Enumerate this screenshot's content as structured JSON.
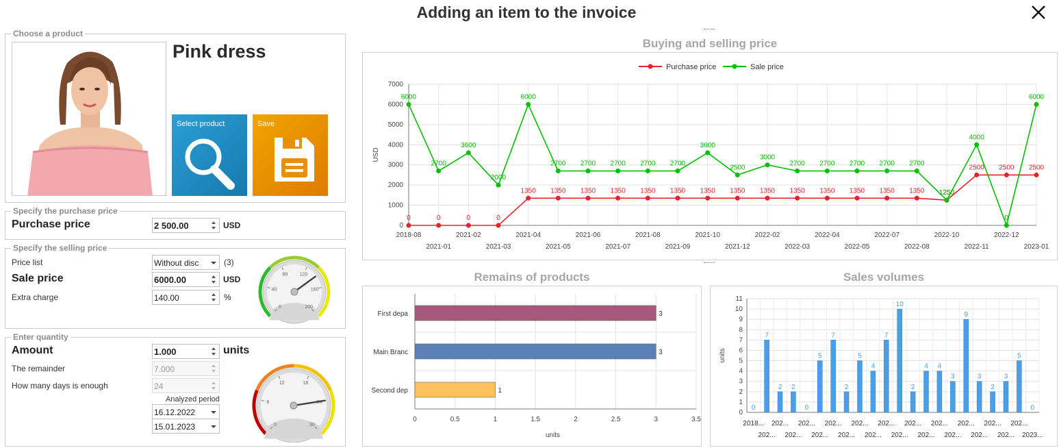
{
  "window": {
    "title": "Adding an item to the invoice"
  },
  "product_group": {
    "legend": "Choose a product",
    "name": "Pink dress",
    "select_label": "Select product",
    "save_label": "Save"
  },
  "purchase_group": {
    "legend": "Specify the purchase price",
    "label": "Purchase price",
    "value": "2 500.00",
    "unit": "USD"
  },
  "selling_group": {
    "legend": "Specify the selling price",
    "price_list_label": "Price list",
    "price_list_value": "Without disc",
    "price_list_count": "(3)",
    "sale_label": "Sale price",
    "sale_value": "6000.00",
    "sale_unit": "USD",
    "extra_label": "Extra charge",
    "extra_value": "140.00",
    "extra_unit": "%",
    "gauge_ticks": [
      "0",
      "40",
      "80",
      "120",
      "160",
      "200"
    ],
    "gauge_value": 140
  },
  "quantity_group": {
    "legend": "Enter quantity",
    "amount_label": "Amount",
    "amount_value": "1.000",
    "amount_unit": "units",
    "remainder_label": "The remainder",
    "remainder_value": "7.000",
    "days_label": "How many days is enough",
    "days_value": "24",
    "period_label": "Analyzed period",
    "date_from": "16.12.2022",
    "date_to": "15.01.2023",
    "gauge_ticks": [
      "0",
      "6",
      "12",
      "18",
      "24",
      "30"
    ],
    "gauge_value": 24
  },
  "colors": {
    "purchase": "#e8212a",
    "sale": "#00c000",
    "bar_blue": "#4c9fe6",
    "remains": [
      "#a4597d",
      "#5b80b8",
      "#ffc05e"
    ]
  },
  "chart_data": [
    {
      "type": "line",
      "title": "Buying and selling price",
      "ylabel": "USD",
      "ylim": [
        0,
        7000
      ],
      "yticks": [
        0,
        1000,
        2000,
        3000,
        4000,
        5000,
        6000,
        7000
      ],
      "legend_position": "top-center",
      "grid": true,
      "x_top_labels": [
        "2018-08",
        "2021-02",
        "2021-04",
        "2021-06",
        "2021-08",
        "2021-10",
        "2022-02",
        "2022-04",
        "2022-07",
        "2022-10",
        "2022-12"
      ],
      "x_bottom_labels": [
        "2021-01",
        "2021-03",
        "2021-05",
        "2021-07",
        "2021-09",
        "2021-12",
        "2022-03",
        "2022-05",
        "2022-08",
        "2022-11",
        "2023-01"
      ],
      "series": [
        {
          "name": "Purchase price",
          "values": [
            0,
            0,
            0,
            0,
            1350,
            1350,
            1350,
            1350,
            1350,
            1350,
            1350,
            1350,
            1350,
            1350,
            1350,
            1350,
            1350,
            1350,
            1250,
            2500,
            2500,
            2500
          ]
        },
        {
          "name": "Sale price",
          "values": [
            6000,
            2700,
            3600,
            2000,
            6000,
            2700,
            2700,
            2700,
            2700,
            2700,
            3600,
            2500,
            3000,
            2700,
            2700,
            2700,
            2700,
            2700,
            1250,
            4000,
            0,
            6000
          ]
        }
      ]
    },
    {
      "type": "bar",
      "orientation": "horizontal",
      "title": "Remains of products",
      "xlabel": "units",
      "xlim": [
        0,
        3.5
      ],
      "xticks": [
        "0",
        "0.5",
        "1",
        "1.5",
        "2",
        "2.5",
        "3",
        "3.5"
      ],
      "categories": [
        "First depa",
        "Main Branc",
        "Second dep"
      ],
      "values": [
        3,
        3,
        1
      ]
    },
    {
      "type": "bar",
      "title": "Sales volumes",
      "ylabel": "units",
      "ylim": [
        0,
        11
      ],
      "yticks": [
        0,
        1,
        2,
        3,
        4,
        5,
        6,
        7,
        8,
        9,
        10,
        11
      ],
      "values": [
        0,
        7,
        2,
        2,
        0,
        5,
        7,
        2,
        5,
        4,
        7,
        10,
        2,
        4,
        4,
        3,
        9,
        3,
        2,
        3,
        5,
        0
      ],
      "x_top_labels": [
        "2018...",
        "202...",
        "202...",
        "202...",
        "202...",
        "202...",
        "202...",
        "202...",
        "202...",
        "202...",
        "202..."
      ],
      "x_bottom_labels": [
        "202...",
        "202...",
        "202...",
        "202...",
        "202...",
        "202...",
        "202...",
        "202...",
        "202...",
        "202...",
        "2023..."
      ]
    }
  ]
}
